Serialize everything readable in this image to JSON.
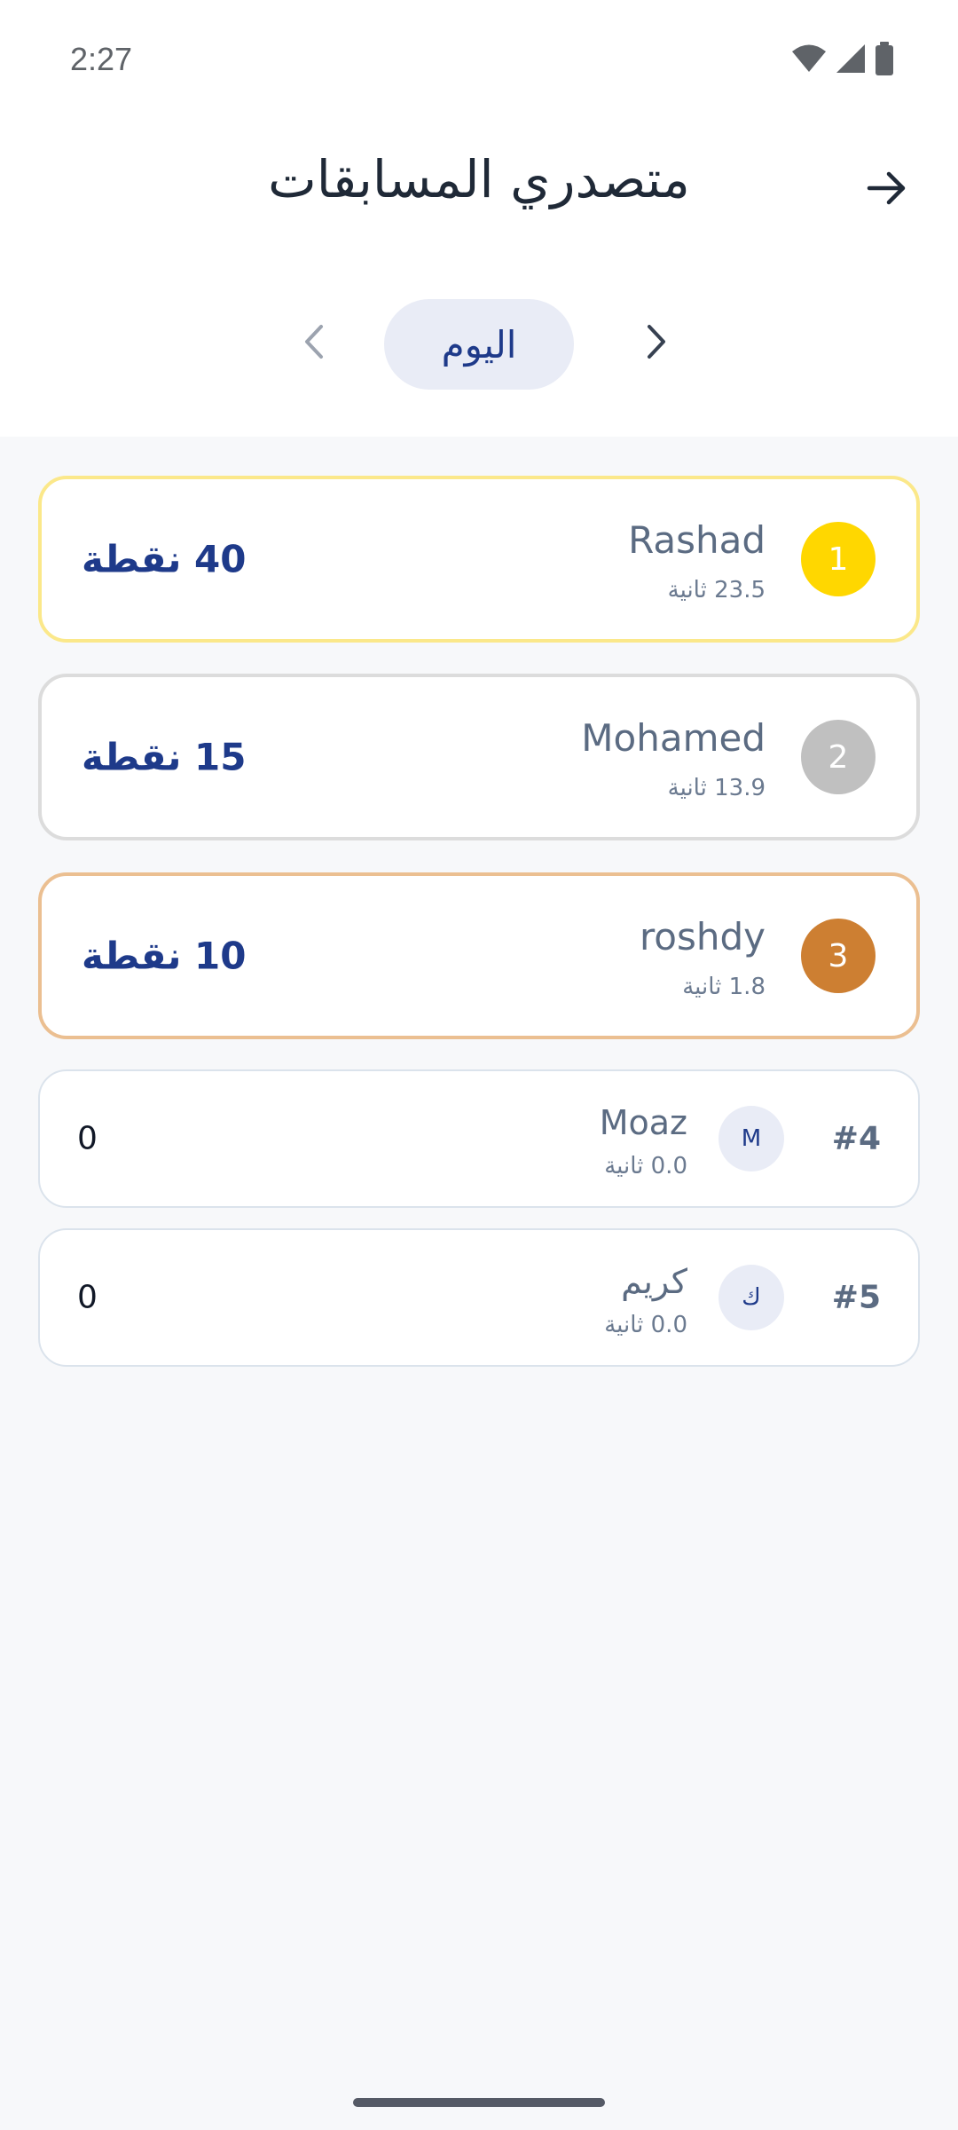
{
  "status_bar": {
    "time": "2:27"
  },
  "header": {
    "title": "متصدري المسابقات"
  },
  "period": {
    "label": "اليوم"
  },
  "colors": {
    "gold": "#FFD700",
    "silver": "#C0C0C0",
    "bronze": "#CD7F32",
    "accent": "#1E3A8A"
  },
  "leaders": [
    {
      "rank": "1",
      "name": "Rashad",
      "time": "23.5 ثانية",
      "score": "40 نقطة"
    },
    {
      "rank": "2",
      "name": "Mohamed",
      "time": "13.9 ثانية",
      "score": "15 نقطة"
    },
    {
      "rank": "3",
      "name": "roshdy",
      "time": "1.8 ثانية",
      "score": "10 نقطة"
    },
    {
      "rank": "#4",
      "initial": "M",
      "name": "Moaz",
      "time": "0.0 ثانية",
      "score": "0"
    },
    {
      "rank": "#5",
      "initial": "ك",
      "name": "كريم",
      "time": "0.0 ثانية",
      "score": "0"
    }
  ]
}
